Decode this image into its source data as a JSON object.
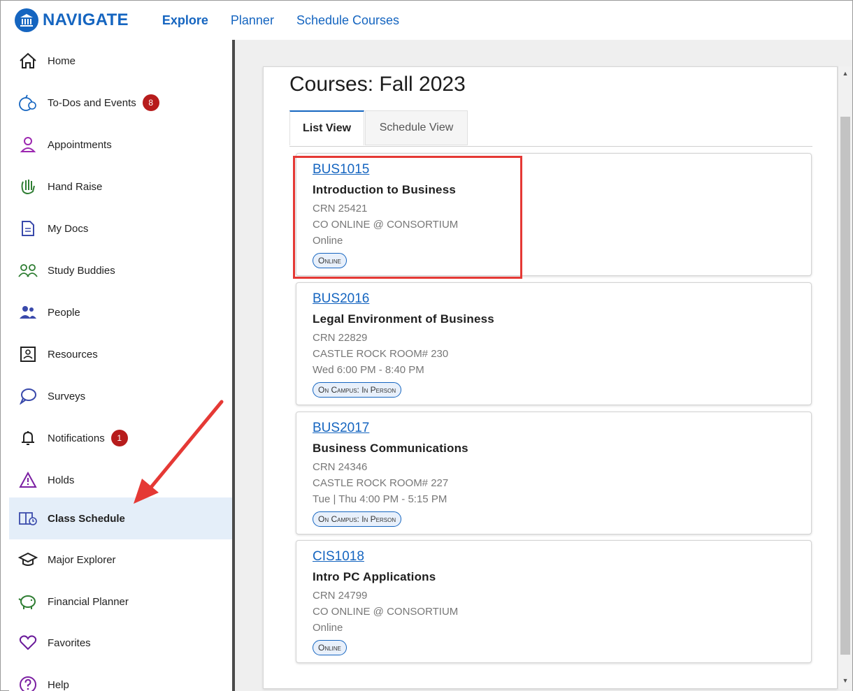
{
  "header": {
    "brand": "NAVIGATE",
    "nav": [
      {
        "label": "Explore",
        "bold": true
      },
      {
        "label": "Planner",
        "bold": false
      },
      {
        "label": "Schedule Courses",
        "bold": false
      }
    ]
  },
  "sidebar": {
    "items": [
      {
        "label": "Home",
        "icon": "home-icon"
      },
      {
        "label": "To-Dos and Events",
        "icon": "todo-icon",
        "badge": "8"
      },
      {
        "label": "Appointments",
        "icon": "person-icon"
      },
      {
        "label": "Hand Raise",
        "icon": "hand-icon"
      },
      {
        "label": "My Docs",
        "icon": "document-icon"
      },
      {
        "label": "Study Buddies",
        "icon": "study-buddies-icon"
      },
      {
        "label": "People",
        "icon": "people-icon"
      },
      {
        "label": "Resources",
        "icon": "resources-icon"
      },
      {
        "label": "Surveys",
        "icon": "chat-bubble-icon"
      },
      {
        "label": "Notifications",
        "icon": "bell-icon",
        "badge": "1"
      },
      {
        "label": "Holds",
        "icon": "warning-icon"
      },
      {
        "label": "Class Schedule",
        "icon": "book-icon",
        "active": true
      },
      {
        "label": "Major Explorer",
        "icon": "graduation-cap-icon"
      },
      {
        "label": "Financial Planner",
        "icon": "piggy-bank-icon"
      },
      {
        "label": "Favorites",
        "icon": "heart-icon"
      },
      {
        "label": "Help",
        "icon": "help-icon"
      }
    ]
  },
  "main": {
    "title": "Courses: Fall 2023",
    "tabs": [
      {
        "label": "List View",
        "active": true
      },
      {
        "label": "Schedule View",
        "active": false
      }
    ],
    "courses": [
      {
        "code": "BUS1015",
        "name": "Introduction to Business",
        "crn": "CRN 25421",
        "location": "CO ONLINE @ CONSORTIUM",
        "time": "Online",
        "tag": "Online"
      },
      {
        "code": "BUS2016",
        "name": "Legal Environment of Business",
        "crn": "CRN 22829",
        "location": "CASTLE ROCK ROOM# 230",
        "time": "Wed 6:00 PM - 8:40 PM",
        "tag": "On Campus: In Person"
      },
      {
        "code": "BUS2017",
        "name": "Business Communications",
        "crn": "CRN 24346",
        "location": "CASTLE ROCK ROOM# 227",
        "time": "Tue | Thu 4:00 PM - 5:15 PM",
        "tag": "On Campus: In Person"
      },
      {
        "code": "CIS1018",
        "name": "Intro PC Applications",
        "crn": "CRN 24799",
        "location": "CO ONLINE @ CONSORTIUM",
        "time": "Online",
        "tag": "Online"
      }
    ]
  },
  "colors": {
    "brand": "#1565c0",
    "badge": "#b71c1c",
    "highlight": "#e53935",
    "active_bg": "#e4eef9"
  }
}
